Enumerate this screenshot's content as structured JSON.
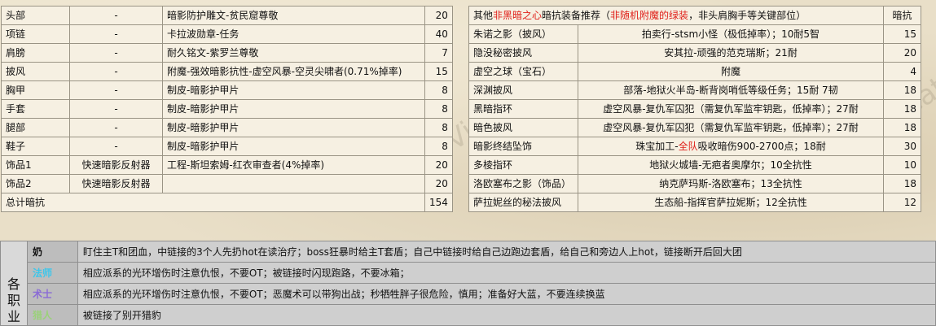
{
  "left_table": {
    "rows": [
      {
        "slot": "头部",
        "item": "-",
        "source": "暗影防护雕文-贫民窟尊敬",
        "value": "20"
      },
      {
        "slot": "项链",
        "item": "-",
        "source": "卡拉波勋章-任务",
        "value": "40"
      },
      {
        "slot": "肩膀",
        "item": "-",
        "source": "耐久铭文-紫罗兰尊敬",
        "value": "7"
      },
      {
        "slot": "披风",
        "item": "-",
        "source": "附魔-强效暗影抗性-虚空风暴-空灵尖啸者(0.71%掉率)",
        "value": "15"
      },
      {
        "slot": "胸甲",
        "item": "-",
        "source": "制皮-暗影护甲片",
        "value": "8"
      },
      {
        "slot": "手套",
        "item": "-",
        "source": "制皮-暗影护甲片",
        "value": "8"
      },
      {
        "slot": "腿部",
        "item": "-",
        "source": "制皮-暗影护甲片",
        "value": "8"
      },
      {
        "slot": "鞋子",
        "item": "-",
        "source": "制皮-暗影护甲片",
        "value": "8"
      },
      {
        "slot": "饰品1",
        "item": "快速暗影反射器",
        "source": "工程-斯坦索姆-红衣审查者(4%掉率)",
        "value": "20"
      },
      {
        "slot": "饰品2",
        "item": "快速暗影反射器",
        "source": "",
        "value": "20"
      }
    ],
    "total_label": "总计暗抗",
    "total_value": "154"
  },
  "right_table": {
    "header": {
      "part1": "其他",
      "part2": "非黑暗之心",
      "part3": "暗抗装备推荐（",
      "part4": "非随机附魔的绿装",
      "part5": "，非头肩胸手等关键部位）",
      "value_label": "暗抗"
    },
    "rows": [
      {
        "item": "朱诺之影（披风）",
        "source": "拍卖行-stsm小怪（极低掉率）；10耐5智",
        "value": "15"
      },
      {
        "item": "隐没秘密披风",
        "source": "安其拉-顽强的范克瑞斯；21耐",
        "value": "20"
      },
      {
        "item": "虚空之球（宝石）",
        "source": "附魔",
        "value": "4"
      },
      {
        "item": "深渊披风",
        "source": "部落-地狱火半岛-断背岗哨低等级任务；15耐 7韧",
        "value": "18"
      },
      {
        "item": "黑暗指环",
        "source": "虚空风暴-复仇军囚犯（需复仇军监牢钥匙，低掉率）；27耐",
        "value": "18"
      },
      {
        "item": "暗色披风",
        "source": "虚空风暴-复仇军囚犯（需复仇军监牢钥匙，低掉率）；27耐",
        "value": "18"
      },
      {
        "item": "暗影终结坠饰",
        "source_pre": "珠宝加工-",
        "source_red": "全队",
        "source_post": "吸收暗伤900-2700点；18耐",
        "value": "30"
      },
      {
        "item": "多棱指环",
        "source": "地狱火城墙-无疤者奥摩尔；10全抗性",
        "value": "10"
      },
      {
        "item": "洛欧塞布之影（饰品）",
        "source": "纳克萨玛斯-洛欧塞布；13全抗性",
        "value": "18"
      },
      {
        "item": "萨拉妮丝的秘法披风",
        "source": "生态船-指挥官萨拉妮斯；12全抗性",
        "value": "12"
      }
    ]
  },
  "watermark": "VisaCat",
  "class_section": {
    "side_label": [
      "各",
      "职",
      "业"
    ],
    "rows": [
      {
        "class": "奶",
        "color": "#111111",
        "text": "盯住主T和团血，中链接的3个人先扔hot在读治疗；boss狂暴时给主T套盾；自己中链接时给自己边跑边套盾，给自己和旁边人上hot，链接断开后回大团"
      },
      {
        "class": "法师",
        "color": "#3ec6ea",
        "text": "相应派系的光环增伤时注意仇恨，不要OT；被链接时闪现跑路，不要冰箱；"
      },
      {
        "class": "术士",
        "color": "#8a6bd6",
        "text": "相应派系的光环增伤时注意仇恨，不要OT；恶魔术可以带狗出战；秒牺牲胖子很危险，慎用；准备好大蓝，不要连续换蓝"
      },
      {
        "class": "猎人",
        "color": "#9bd17a",
        "text": "被链接了别开猎豹"
      }
    ]
  }
}
